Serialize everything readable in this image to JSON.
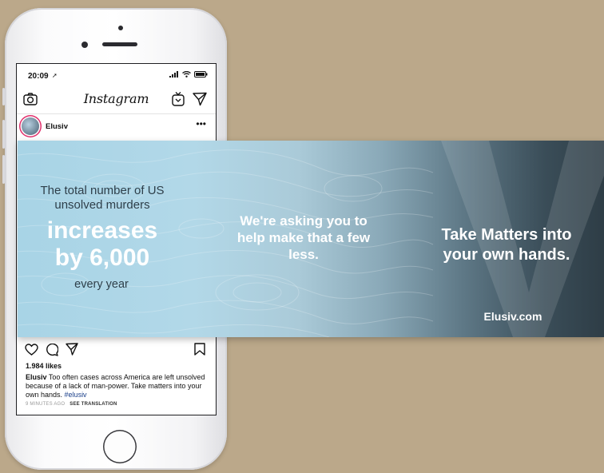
{
  "phone": {
    "status": {
      "time": "20:09"
    },
    "instagram": {
      "logo": "Instagram",
      "post": {
        "username": "Elusiv",
        "menu": "•••",
        "likes": "1.984 likes",
        "caption_user": "Elusiv",
        "caption_text": " Too often cases across America are left unsolved because of a lack of man-power. Take matters into your own hands. ",
        "hashtag": "#elusiv",
        "time_ago": "9 MINUTES AGO",
        "see_translation": "SEE TRANSLATION"
      }
    }
  },
  "banner": {
    "intro": "The total number of US unsolved murders",
    "highlight_line1": "increases",
    "highlight_line2": "by 6,000",
    "period": "every year",
    "middle_message": "We're asking you to help make that a few less.",
    "tagline": "Take Matters into your own hands.",
    "website": "Elusiv.com"
  },
  "icons": {
    "camera": "camera-icon",
    "igtv": "igtv-icon",
    "direct": "direct-message-icon",
    "like": "heart-icon",
    "comment": "comment-icon",
    "share": "share-icon",
    "save": "bookmark-icon"
  }
}
